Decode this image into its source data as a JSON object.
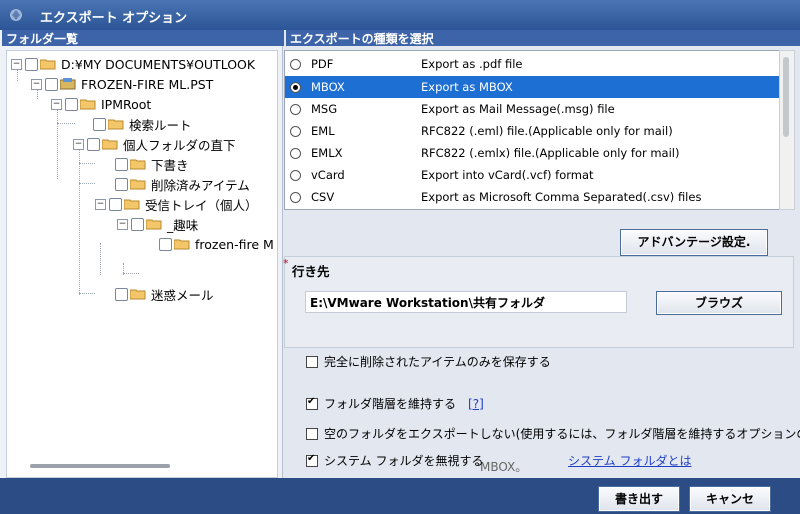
{
  "window": {
    "title": "エクスポート オプション"
  },
  "folders": {
    "header": "フォルダ一覧",
    "tree": [
      {
        "label": "D:¥MY DOCUMENTS¥OUTLOOK",
        "expanded": true
      },
      {
        "label": "FROZEN-FIRE ML.PST",
        "expanded": true
      },
      {
        "label": "IPMRoot",
        "expanded": true
      },
      {
        "label": "検索ルート"
      },
      {
        "label": "個人フォルダの直下",
        "expanded": true
      },
      {
        "label": "下書き"
      },
      {
        "label": "削除済みアイテム"
      },
      {
        "label": "受信トレイ（個人）",
        "expanded": true
      },
      {
        "label": "_趣味",
        "expanded": true
      },
      {
        "label": "frozen-fire M"
      },
      {
        "label": "迷惑メール"
      }
    ]
  },
  "export_type": {
    "header": "エクスポートの種類を選択",
    "selected": "MBOX",
    "options": [
      {
        "format": "PDF",
        "description": "Export as .pdf file"
      },
      {
        "format": "MBOX",
        "description": "Export as MBOX"
      },
      {
        "format": "MSG",
        "description": "Export as Mail Message(.msg) file"
      },
      {
        "format": "EML",
        "description": "RFC822 (.eml) file.(Applicable only for mail)"
      },
      {
        "format": "EMLX",
        "description": "RFC822 (.emlx) file.(Applicable only for mail)"
      },
      {
        "format": "vCard",
        "description": "Export into vCard(.vcf) format"
      },
      {
        "format": "CSV",
        "description": "Export as Microsoft Comma Separated(.csv) files"
      }
    ]
  },
  "advanced_button": "アドバンテージ設定.",
  "destination": {
    "required_mark": "*",
    "label": "行き先",
    "path": "E:\\VMware Workstation\\共有フォルダ",
    "browse_button": "ブラウズ"
  },
  "options": {
    "deleted_only": {
      "label": "完全に削除されたアイテムのみを保存する",
      "checked": false
    },
    "keep_hierarchy": {
      "label": "フォルダ階層を維持する",
      "checked": true,
      "help": "[?]"
    },
    "skip_empty": {
      "label": "空のフォルダをエクスポートしない(使用するには、フォルダ階層を維持するオプションの...",
      "checked": false
    },
    "ignore_system": {
      "label": "システム フォルダを無視する",
      "checked": true,
      "link": "システム フォルダとは"
    },
    "ghost_text": "MBOX。"
  },
  "footer": {
    "export_button": "書き出す",
    "cancel_button": "キャンセ"
  }
}
